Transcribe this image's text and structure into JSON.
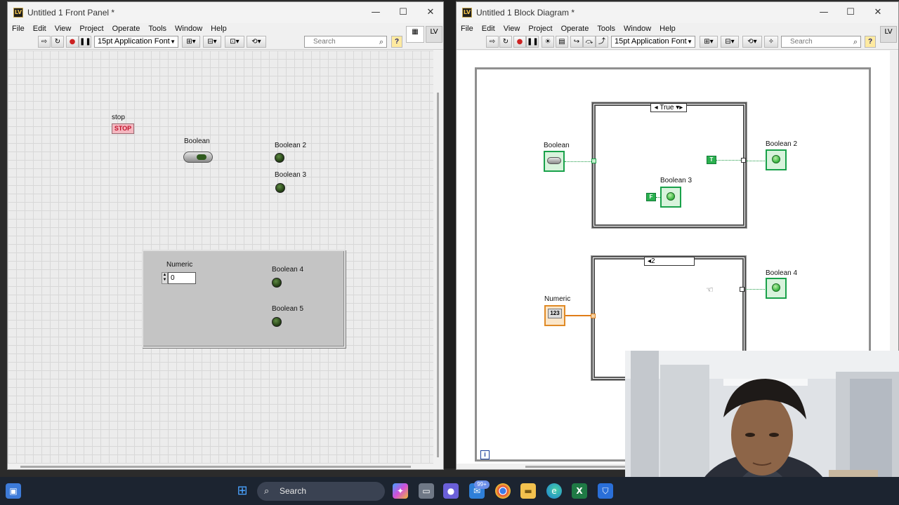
{
  "front_panel": {
    "title": "Untitled 1 Front Panel *",
    "menu": [
      "File",
      "Edit",
      "View",
      "Project",
      "Operate",
      "Tools",
      "Window",
      "Help"
    ],
    "font_select": "15pt Application Font",
    "search_placeholder": "Search",
    "controls": {
      "stop_label": "stop",
      "stop_text": "STOP",
      "boolean_label": "Boolean",
      "boolean2_label": "Boolean 2",
      "boolean3_label": "Boolean 3",
      "numeric_label": "Numeric",
      "numeric_value": "0",
      "boolean4_label": "Boolean 4",
      "boolean5_label": "Boolean 5"
    }
  },
  "block_diagram": {
    "title": "Untitled 1 Block Diagram *",
    "menu": [
      "File",
      "Edit",
      "View",
      "Project",
      "Operate",
      "Tools",
      "Window",
      "Help"
    ],
    "font_select": "15pt Application Font",
    "search_placeholder": "Search",
    "case1_selector": "True",
    "case2_selector": "2",
    "boolean_label": "Boolean",
    "boolean2_label": "Boolean 2",
    "boolean3_label": "Boolean 3",
    "boolean4_label": "Boolean 4",
    "numeric_label": "Numeric",
    "numeric_term_text": "123",
    "true_const": "T",
    "false_const": "F",
    "iteration_label": "i"
  },
  "taskbar": {
    "search_label": "Search",
    "mail_badge": "99+"
  },
  "colors": {
    "boolean_wire": "#1b9a43",
    "numeric_wire": "#e07d18",
    "stop_button": "#f4b7c0",
    "taskbar": "#1c2430"
  }
}
